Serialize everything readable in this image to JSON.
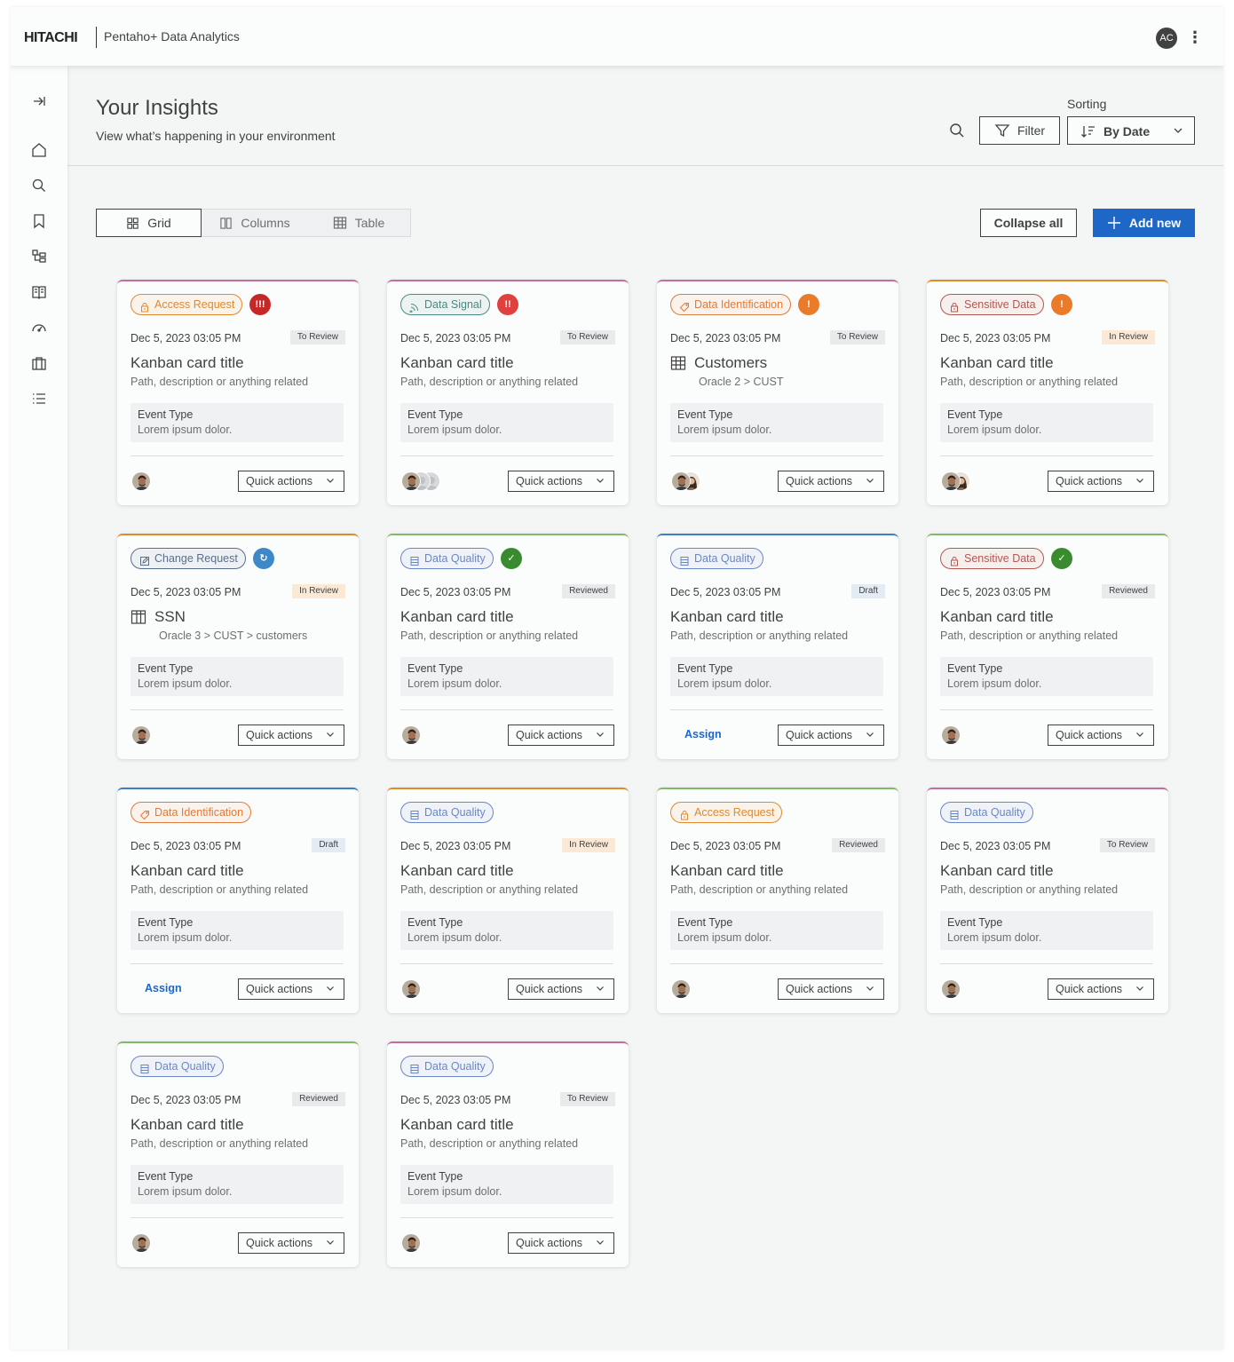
{
  "header": {
    "logo": "HITACHI",
    "app_name": "Pentaho+ Data Analytics",
    "user_initials": "AC",
    "menu_icon": "kebab-icon"
  },
  "sidebar": {
    "items": [
      {
        "icon": "expand-sidebar-icon"
      },
      {
        "icon": "home-icon"
      },
      {
        "icon": "search-icon"
      },
      {
        "icon": "bookmark-icon"
      },
      {
        "icon": "hierarchy-icon"
      },
      {
        "icon": "book-icon"
      },
      {
        "icon": "gauge-icon"
      },
      {
        "icon": "briefcase-icon"
      },
      {
        "icon": "list-icon"
      }
    ]
  },
  "page": {
    "title": "Your Insights",
    "subtitle": "View what’s happening in your environment",
    "filter_label": "Filter",
    "sorting_label": "Sorting",
    "sorting_value": "By Date"
  },
  "toolbar": {
    "views": [
      {
        "label": "Grid",
        "active": true
      },
      {
        "label": "Columns",
        "active": false
      },
      {
        "label": "Table",
        "active": false
      }
    ],
    "collapse_label": "Collapse all",
    "add_label": "Add new"
  },
  "common": {
    "quick_actions": "Quick actions",
    "assign": "Assign",
    "event_label": "Event Type",
    "event_value": "Lorem ipsum dolor."
  },
  "colors": {
    "primary": "#1f67c7",
    "priority_critical": "#c62828",
    "priority_high": "#e0403e",
    "priority_medium": "#e97b2a",
    "priority_done": "#3a8b2f",
    "priority_progress": "#3d88c9"
  },
  "cards": [
    {
      "tag": "Access Request",
      "tag_color": "#e2892b",
      "tag_icon": "lock-icon",
      "priority": "critical",
      "date": "Dec 5, 2023 03:05 PM",
      "status": "To Review",
      "status_color": "#e8eaec",
      "title": "Kanban card title",
      "path": "Path, description or anything related",
      "avatars": [
        "a"
      ],
      "assign": false,
      "border": "#c66b9e"
    },
    {
      "tag": "Data Signal",
      "tag_color": "#4a8a80",
      "tag_icon": "signal-icon",
      "priority": "high",
      "date": "Dec 5, 2023 03:05 PM",
      "status": "To Review",
      "status_color": "#e8eaec",
      "title": "Kanban card title",
      "path": "Path, description or anything related",
      "avatars": [
        "a",
        "g",
        "g"
      ],
      "assign": false,
      "border": "#c66b9e"
    },
    {
      "tag": "Data Identification",
      "tag_color": "#e07b3a",
      "tag_icon": "tag-icon",
      "priority": "medium",
      "date": "Dec 5, 2023 03:05 PM",
      "status": "To Review",
      "status_color": "#e8eaec",
      "title": "Customers",
      "title_icon": "table-icon",
      "path": "Oracle 2 > CUST",
      "avatars": [
        "a",
        "b"
      ],
      "assign": false,
      "border": "#c66b9e"
    },
    {
      "tag": "Sensitive Data",
      "tag_color": "#b5564f",
      "tag_icon": "lock-icon",
      "priority": "medium",
      "date": "Dec 5, 2023 03:05 PM",
      "status": "In Review",
      "status_color": "#fbe9d6",
      "title": "Kanban card title",
      "path": "Path, description or anything related",
      "avatars": [
        "a",
        "b"
      ],
      "assign": false,
      "border": "#e2892b"
    },
    {
      "tag": "Change Request",
      "tag_color": "#5a6e8c",
      "tag_icon": "edit-icon",
      "priority": "progress",
      "date": "Dec 5, 2023 03:05 PM",
      "status": "In Review",
      "status_color": "#fbe9d6",
      "title": "SSN",
      "title_icon": "column-icon",
      "path": "Oracle 3 > CUST > customers",
      "avatars": [
        "a"
      ],
      "assign": false,
      "border": "#e2892b"
    },
    {
      "tag": "Data Quality",
      "tag_color": "#6a86c6",
      "tag_icon": "database-icon",
      "priority": "done",
      "date": "Dec 5, 2023 03:05 PM",
      "status": "Reviewed",
      "status_color": "#e8eaec",
      "title": "Kanban card title",
      "path": "Path, description or anything related",
      "avatars": [
        "a"
      ],
      "assign": false,
      "border": "#82b86a"
    },
    {
      "tag": "Data Quality",
      "tag_color": "#6a86c6",
      "tag_icon": "database-icon",
      "priority": "",
      "date": "Dec 5, 2023 03:05 PM",
      "status": "Draft",
      "status_color": "#e3ebf3",
      "title": "Kanban card title",
      "path": "Path, description or anything related",
      "avatars": [],
      "assign": true,
      "border": "#3d7fc2"
    },
    {
      "tag": "Sensitive Data",
      "tag_color": "#b5564f",
      "tag_icon": "lock-icon",
      "priority": "done",
      "date": "Dec 5, 2023 03:05 PM",
      "status": "Reviewed",
      "status_color": "#e8eaec",
      "title": "Kanban card title",
      "path": "Path, description or anything related",
      "avatars": [
        "a"
      ],
      "assign": false,
      "border": "#82b86a"
    },
    {
      "tag": "Data Identification",
      "tag_color": "#e07b3a",
      "tag_icon": "tag-icon",
      "priority": "",
      "date": "Dec 5, 2023 03:05 PM",
      "status": "Draft",
      "status_color": "#e3ebf3",
      "title": "Kanban card title",
      "path": "Path, description or anything related",
      "avatars": [],
      "assign": true,
      "border": "#3d7fc2"
    },
    {
      "tag": "Data Quality",
      "tag_color": "#6a86c6",
      "tag_icon": "database-icon",
      "priority": "",
      "date": "Dec 5, 2023 03:05 PM",
      "status": "In Review",
      "status_color": "#fbe9d6",
      "title": "Kanban card title",
      "path": "Path, description or anything related",
      "avatars": [
        "a"
      ],
      "assign": false,
      "border": "#e2892b"
    },
    {
      "tag": "Access Request",
      "tag_color": "#e2892b",
      "tag_icon": "lock-icon",
      "priority": "",
      "date": "Dec 5, 2023 03:05 PM",
      "status": "Reviewed",
      "status_color": "#e8eaec",
      "title": "Kanban card title",
      "path": "Path, description or anything related",
      "avatars": [
        "a"
      ],
      "assign": false,
      "border": "#82b86a"
    },
    {
      "tag": "Data Quality",
      "tag_color": "#6a86c6",
      "tag_icon": "database-icon",
      "priority": "",
      "date": "Dec 5, 2023 03:05 PM",
      "status": "To Review",
      "status_color": "#e8eaec",
      "title": "Kanban card title",
      "path": "Path, description or anything related",
      "avatars": [
        "a"
      ],
      "assign": false,
      "border": "#c66b9e"
    },
    {
      "tag": "Data Quality",
      "tag_color": "#6a86c6",
      "tag_icon": "database-icon",
      "priority": "",
      "date": "Dec 5, 2023 03:05 PM",
      "status": "Reviewed",
      "status_color": "#e8eaec",
      "title": "Kanban card title",
      "path": "Path, description or anything related",
      "avatars": [
        "a"
      ],
      "assign": false,
      "border": "#82b86a"
    },
    {
      "tag": "Data Quality",
      "tag_color": "#6a86c6",
      "tag_icon": "database-icon",
      "priority": "",
      "date": "Dec 5, 2023 03:05 PM",
      "status": "To Review",
      "status_color": "#e8eaec",
      "title": "Kanban card title",
      "path": "Path, description or anything related",
      "avatars": [
        "a"
      ],
      "assign": false,
      "border": "#c66b9e"
    }
  ]
}
